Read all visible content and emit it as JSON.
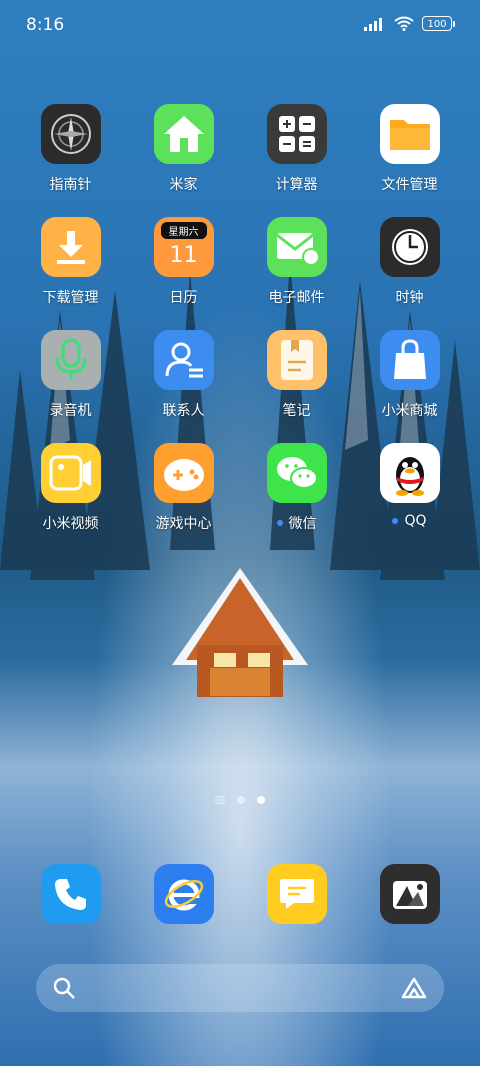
{
  "status": {
    "time": "8:16",
    "battery": "100"
  },
  "apps": [
    {
      "label": "指南针",
      "icon": "compass-icon"
    },
    {
      "label": "米家",
      "icon": "home-icon"
    },
    {
      "label": "计算器",
      "icon": "calculator-icon"
    },
    {
      "label": "文件管理",
      "icon": "folder-icon"
    },
    {
      "label": "下载管理",
      "icon": "download-icon"
    },
    {
      "label": "日历",
      "icon": "calendar-icon",
      "weekday": "星期六",
      "day": "11"
    },
    {
      "label": "电子邮件",
      "icon": "mail-icon"
    },
    {
      "label": "时钟",
      "icon": "clock-icon"
    },
    {
      "label": "录音机",
      "icon": "microphone-icon"
    },
    {
      "label": "联系人",
      "icon": "contacts-icon"
    },
    {
      "label": "笔记",
      "icon": "notes-icon"
    },
    {
      "label": "小米商城",
      "icon": "shopping-bag-icon"
    },
    {
      "label": "小米视频",
      "icon": "video-icon"
    },
    {
      "label": "游戏中心",
      "icon": "gamepad-icon"
    },
    {
      "label": "微信",
      "icon": "wechat-icon"
    },
    {
      "label": "QQ",
      "icon": "qq-penguin-icon"
    }
  ],
  "dock": [
    {
      "icon": "phone-icon"
    },
    {
      "icon": "internet-explorer-icon"
    },
    {
      "icon": "messages-icon"
    },
    {
      "icon": "gallery-icon"
    }
  ],
  "colors": {
    "compass": "#2b2b2b",
    "mijia": "#5ee15a",
    "calculator": "#3a3a3a",
    "files": "#ffffff",
    "download": "#ffb347",
    "calendar": "#ff9a3c",
    "mail": "#5ee15a",
    "clock": "#2b2b2b",
    "recorder": "#a8b0b0",
    "contacts": "#3d8cf0",
    "notes": "#ffc06a",
    "mall": "#3d8cf0",
    "video": "#ffcf33",
    "game": "#ff9f2e",
    "wechat": "#3fe34a",
    "qq": "#ffffff",
    "phone": "#1f9bf0",
    "browser": "#2d7ff0",
    "messages": "#ffcc1f",
    "gallery": "#2e2e2e"
  }
}
